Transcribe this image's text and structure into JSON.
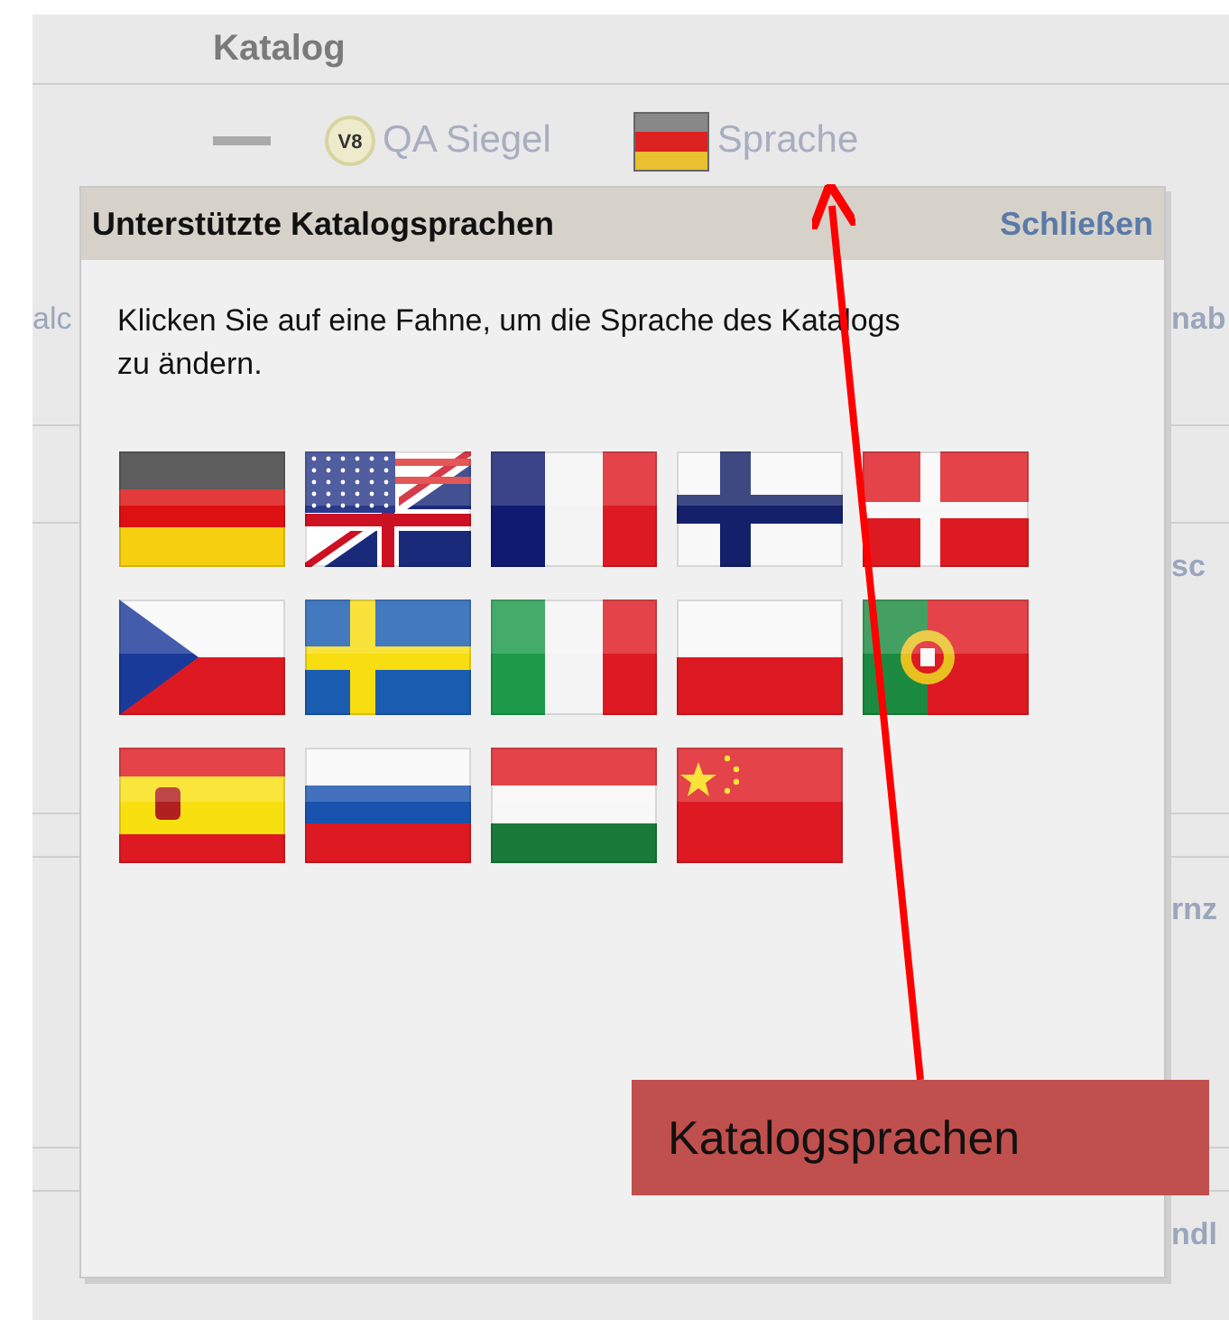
{
  "header": {
    "title": "Katalog"
  },
  "toolbar": {
    "items": [
      {
        "kind": "logo"
      },
      {
        "kind": "seal",
        "badge": "V8",
        "label": "QA Siegel"
      },
      {
        "kind": "language",
        "label": "Sprache"
      }
    ]
  },
  "background_rows": [
    {
      "left": "alc",
      "right": "nab"
    },
    {
      "right": "sc"
    },
    {
      "right": "rnz"
    },
    {
      "right": "ndl"
    }
  ],
  "popup": {
    "title": "Unterstützte Katalogsprachen",
    "close": "Schließen",
    "instruction": "Klicken Sie auf eine Fahne, um die Sprache des Katalogs zu ändern.",
    "flags": [
      {
        "kind": "de"
      },
      {
        "kind": "us-gb"
      },
      {
        "kind": "fr"
      },
      {
        "kind": "fi"
      },
      {
        "kind": "dk"
      },
      {
        "kind": "cz"
      },
      {
        "kind": "se"
      },
      {
        "kind": "it"
      },
      {
        "kind": "pl"
      },
      {
        "kind": "pt"
      },
      {
        "kind": "es"
      },
      {
        "kind": "ru"
      },
      {
        "kind": "hu"
      },
      {
        "kind": "cn"
      }
    ]
  },
  "annotation": {
    "callout": "Katalogsprachen"
  }
}
